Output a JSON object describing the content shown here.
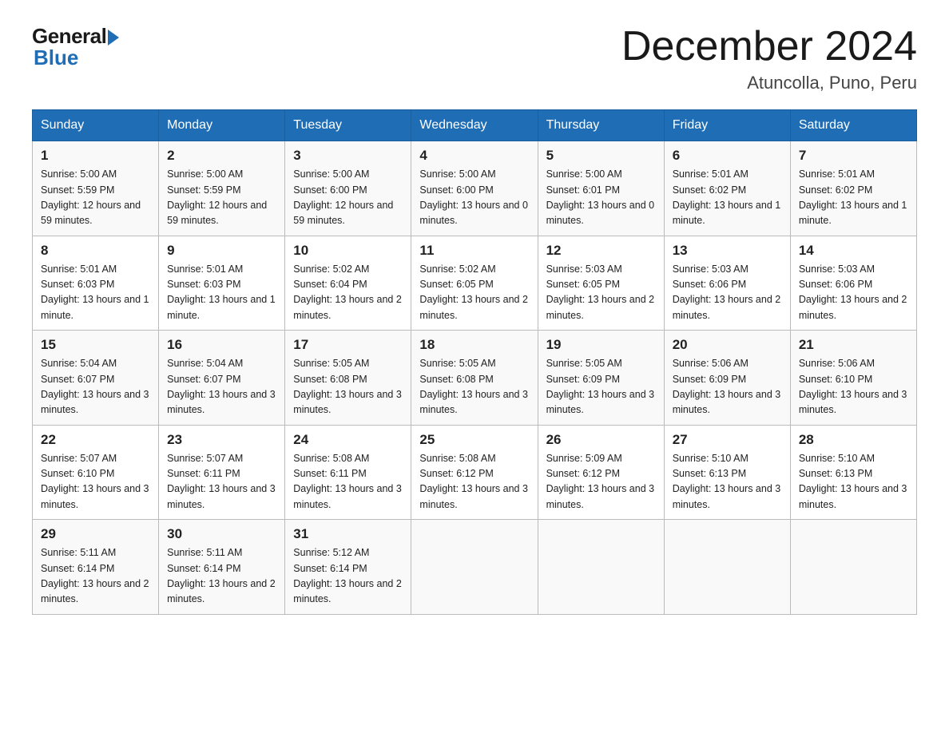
{
  "header": {
    "logo_general": "General",
    "logo_blue": "Blue",
    "month_title": "December 2024",
    "location": "Atuncolla, Puno, Peru"
  },
  "days_of_week": [
    "Sunday",
    "Monday",
    "Tuesday",
    "Wednesday",
    "Thursday",
    "Friday",
    "Saturday"
  ],
  "weeks": [
    [
      {
        "day": "1",
        "sunrise": "5:00 AM",
        "sunset": "5:59 PM",
        "daylight": "12 hours and 59 minutes."
      },
      {
        "day": "2",
        "sunrise": "5:00 AM",
        "sunset": "5:59 PM",
        "daylight": "12 hours and 59 minutes."
      },
      {
        "day": "3",
        "sunrise": "5:00 AM",
        "sunset": "6:00 PM",
        "daylight": "12 hours and 59 minutes."
      },
      {
        "day": "4",
        "sunrise": "5:00 AM",
        "sunset": "6:00 PM",
        "daylight": "13 hours and 0 minutes."
      },
      {
        "day": "5",
        "sunrise": "5:00 AM",
        "sunset": "6:01 PM",
        "daylight": "13 hours and 0 minutes."
      },
      {
        "day": "6",
        "sunrise": "5:01 AM",
        "sunset": "6:02 PM",
        "daylight": "13 hours and 1 minute."
      },
      {
        "day": "7",
        "sunrise": "5:01 AM",
        "sunset": "6:02 PM",
        "daylight": "13 hours and 1 minute."
      }
    ],
    [
      {
        "day": "8",
        "sunrise": "5:01 AM",
        "sunset": "6:03 PM",
        "daylight": "13 hours and 1 minute."
      },
      {
        "day": "9",
        "sunrise": "5:01 AM",
        "sunset": "6:03 PM",
        "daylight": "13 hours and 1 minute."
      },
      {
        "day": "10",
        "sunrise": "5:02 AM",
        "sunset": "6:04 PM",
        "daylight": "13 hours and 2 minutes."
      },
      {
        "day": "11",
        "sunrise": "5:02 AM",
        "sunset": "6:05 PM",
        "daylight": "13 hours and 2 minutes."
      },
      {
        "day": "12",
        "sunrise": "5:03 AM",
        "sunset": "6:05 PM",
        "daylight": "13 hours and 2 minutes."
      },
      {
        "day": "13",
        "sunrise": "5:03 AM",
        "sunset": "6:06 PM",
        "daylight": "13 hours and 2 minutes."
      },
      {
        "day": "14",
        "sunrise": "5:03 AM",
        "sunset": "6:06 PM",
        "daylight": "13 hours and 2 minutes."
      }
    ],
    [
      {
        "day": "15",
        "sunrise": "5:04 AM",
        "sunset": "6:07 PM",
        "daylight": "13 hours and 3 minutes."
      },
      {
        "day": "16",
        "sunrise": "5:04 AM",
        "sunset": "6:07 PM",
        "daylight": "13 hours and 3 minutes."
      },
      {
        "day": "17",
        "sunrise": "5:05 AM",
        "sunset": "6:08 PM",
        "daylight": "13 hours and 3 minutes."
      },
      {
        "day": "18",
        "sunrise": "5:05 AM",
        "sunset": "6:08 PM",
        "daylight": "13 hours and 3 minutes."
      },
      {
        "day": "19",
        "sunrise": "5:05 AM",
        "sunset": "6:09 PM",
        "daylight": "13 hours and 3 minutes."
      },
      {
        "day": "20",
        "sunrise": "5:06 AM",
        "sunset": "6:09 PM",
        "daylight": "13 hours and 3 minutes."
      },
      {
        "day": "21",
        "sunrise": "5:06 AM",
        "sunset": "6:10 PM",
        "daylight": "13 hours and 3 minutes."
      }
    ],
    [
      {
        "day": "22",
        "sunrise": "5:07 AM",
        "sunset": "6:10 PM",
        "daylight": "13 hours and 3 minutes."
      },
      {
        "day": "23",
        "sunrise": "5:07 AM",
        "sunset": "6:11 PM",
        "daylight": "13 hours and 3 minutes."
      },
      {
        "day": "24",
        "sunrise": "5:08 AM",
        "sunset": "6:11 PM",
        "daylight": "13 hours and 3 minutes."
      },
      {
        "day": "25",
        "sunrise": "5:08 AM",
        "sunset": "6:12 PM",
        "daylight": "13 hours and 3 minutes."
      },
      {
        "day": "26",
        "sunrise": "5:09 AM",
        "sunset": "6:12 PM",
        "daylight": "13 hours and 3 minutes."
      },
      {
        "day": "27",
        "sunrise": "5:10 AM",
        "sunset": "6:13 PM",
        "daylight": "13 hours and 3 minutes."
      },
      {
        "day": "28",
        "sunrise": "5:10 AM",
        "sunset": "6:13 PM",
        "daylight": "13 hours and 3 minutes."
      }
    ],
    [
      {
        "day": "29",
        "sunrise": "5:11 AM",
        "sunset": "6:14 PM",
        "daylight": "13 hours and 2 minutes."
      },
      {
        "day": "30",
        "sunrise": "5:11 AM",
        "sunset": "6:14 PM",
        "daylight": "13 hours and 2 minutes."
      },
      {
        "day": "31",
        "sunrise": "5:12 AM",
        "sunset": "6:14 PM",
        "daylight": "13 hours and 2 minutes."
      },
      null,
      null,
      null,
      null
    ]
  ]
}
